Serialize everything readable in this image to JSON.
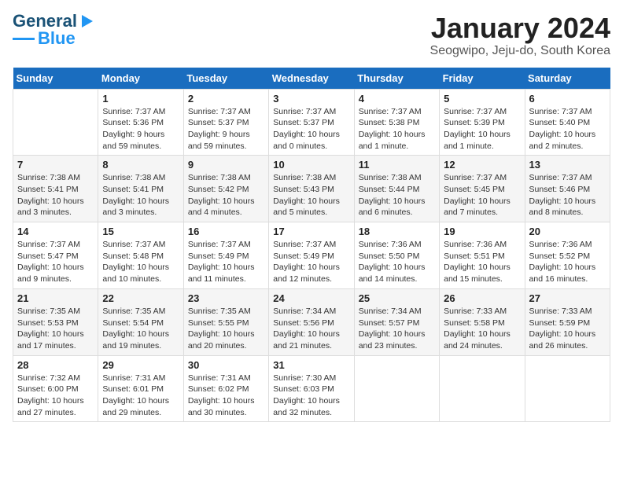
{
  "logo": {
    "line1": "General",
    "line2": "Blue"
  },
  "title": "January 2024",
  "subtitle": "Seogwipo, Jeju-do, South Korea",
  "headers": [
    "Sunday",
    "Monday",
    "Tuesday",
    "Wednesday",
    "Thursday",
    "Friday",
    "Saturday"
  ],
  "weeks": [
    [
      {
        "day": "",
        "info": ""
      },
      {
        "day": "1",
        "info": "Sunrise: 7:37 AM\nSunset: 5:36 PM\nDaylight: 9 hours\nand 59 minutes."
      },
      {
        "day": "2",
        "info": "Sunrise: 7:37 AM\nSunset: 5:37 PM\nDaylight: 9 hours\nand 59 minutes."
      },
      {
        "day": "3",
        "info": "Sunrise: 7:37 AM\nSunset: 5:37 PM\nDaylight: 10 hours\nand 0 minutes."
      },
      {
        "day": "4",
        "info": "Sunrise: 7:37 AM\nSunset: 5:38 PM\nDaylight: 10 hours\nand 1 minute."
      },
      {
        "day": "5",
        "info": "Sunrise: 7:37 AM\nSunset: 5:39 PM\nDaylight: 10 hours\nand 1 minute."
      },
      {
        "day": "6",
        "info": "Sunrise: 7:37 AM\nSunset: 5:40 PM\nDaylight: 10 hours\nand 2 minutes."
      }
    ],
    [
      {
        "day": "7",
        "info": "Sunrise: 7:38 AM\nSunset: 5:41 PM\nDaylight: 10 hours\nand 3 minutes."
      },
      {
        "day": "8",
        "info": "Sunrise: 7:38 AM\nSunset: 5:41 PM\nDaylight: 10 hours\nand 3 minutes."
      },
      {
        "day": "9",
        "info": "Sunrise: 7:38 AM\nSunset: 5:42 PM\nDaylight: 10 hours\nand 4 minutes."
      },
      {
        "day": "10",
        "info": "Sunrise: 7:38 AM\nSunset: 5:43 PM\nDaylight: 10 hours\nand 5 minutes."
      },
      {
        "day": "11",
        "info": "Sunrise: 7:38 AM\nSunset: 5:44 PM\nDaylight: 10 hours\nand 6 minutes."
      },
      {
        "day": "12",
        "info": "Sunrise: 7:37 AM\nSunset: 5:45 PM\nDaylight: 10 hours\nand 7 minutes."
      },
      {
        "day": "13",
        "info": "Sunrise: 7:37 AM\nSunset: 5:46 PM\nDaylight: 10 hours\nand 8 minutes."
      }
    ],
    [
      {
        "day": "14",
        "info": "Sunrise: 7:37 AM\nSunset: 5:47 PM\nDaylight: 10 hours\nand 9 minutes."
      },
      {
        "day": "15",
        "info": "Sunrise: 7:37 AM\nSunset: 5:48 PM\nDaylight: 10 hours\nand 10 minutes."
      },
      {
        "day": "16",
        "info": "Sunrise: 7:37 AM\nSunset: 5:49 PM\nDaylight: 10 hours\nand 11 minutes."
      },
      {
        "day": "17",
        "info": "Sunrise: 7:37 AM\nSunset: 5:49 PM\nDaylight: 10 hours\nand 12 minutes."
      },
      {
        "day": "18",
        "info": "Sunrise: 7:36 AM\nSunset: 5:50 PM\nDaylight: 10 hours\nand 14 minutes."
      },
      {
        "day": "19",
        "info": "Sunrise: 7:36 AM\nSunset: 5:51 PM\nDaylight: 10 hours\nand 15 minutes."
      },
      {
        "day": "20",
        "info": "Sunrise: 7:36 AM\nSunset: 5:52 PM\nDaylight: 10 hours\nand 16 minutes."
      }
    ],
    [
      {
        "day": "21",
        "info": "Sunrise: 7:35 AM\nSunset: 5:53 PM\nDaylight: 10 hours\nand 17 minutes."
      },
      {
        "day": "22",
        "info": "Sunrise: 7:35 AM\nSunset: 5:54 PM\nDaylight: 10 hours\nand 19 minutes."
      },
      {
        "day": "23",
        "info": "Sunrise: 7:35 AM\nSunset: 5:55 PM\nDaylight: 10 hours\nand 20 minutes."
      },
      {
        "day": "24",
        "info": "Sunrise: 7:34 AM\nSunset: 5:56 PM\nDaylight: 10 hours\nand 21 minutes."
      },
      {
        "day": "25",
        "info": "Sunrise: 7:34 AM\nSunset: 5:57 PM\nDaylight: 10 hours\nand 23 minutes."
      },
      {
        "day": "26",
        "info": "Sunrise: 7:33 AM\nSunset: 5:58 PM\nDaylight: 10 hours\nand 24 minutes."
      },
      {
        "day": "27",
        "info": "Sunrise: 7:33 AM\nSunset: 5:59 PM\nDaylight: 10 hours\nand 26 minutes."
      }
    ],
    [
      {
        "day": "28",
        "info": "Sunrise: 7:32 AM\nSunset: 6:00 PM\nDaylight: 10 hours\nand 27 minutes."
      },
      {
        "day": "29",
        "info": "Sunrise: 7:31 AM\nSunset: 6:01 PM\nDaylight: 10 hours\nand 29 minutes."
      },
      {
        "day": "30",
        "info": "Sunrise: 7:31 AM\nSunset: 6:02 PM\nDaylight: 10 hours\nand 30 minutes."
      },
      {
        "day": "31",
        "info": "Sunrise: 7:30 AM\nSunset: 6:03 PM\nDaylight: 10 hours\nand 32 minutes."
      },
      {
        "day": "",
        "info": ""
      },
      {
        "day": "",
        "info": ""
      },
      {
        "day": "",
        "info": ""
      }
    ]
  ]
}
